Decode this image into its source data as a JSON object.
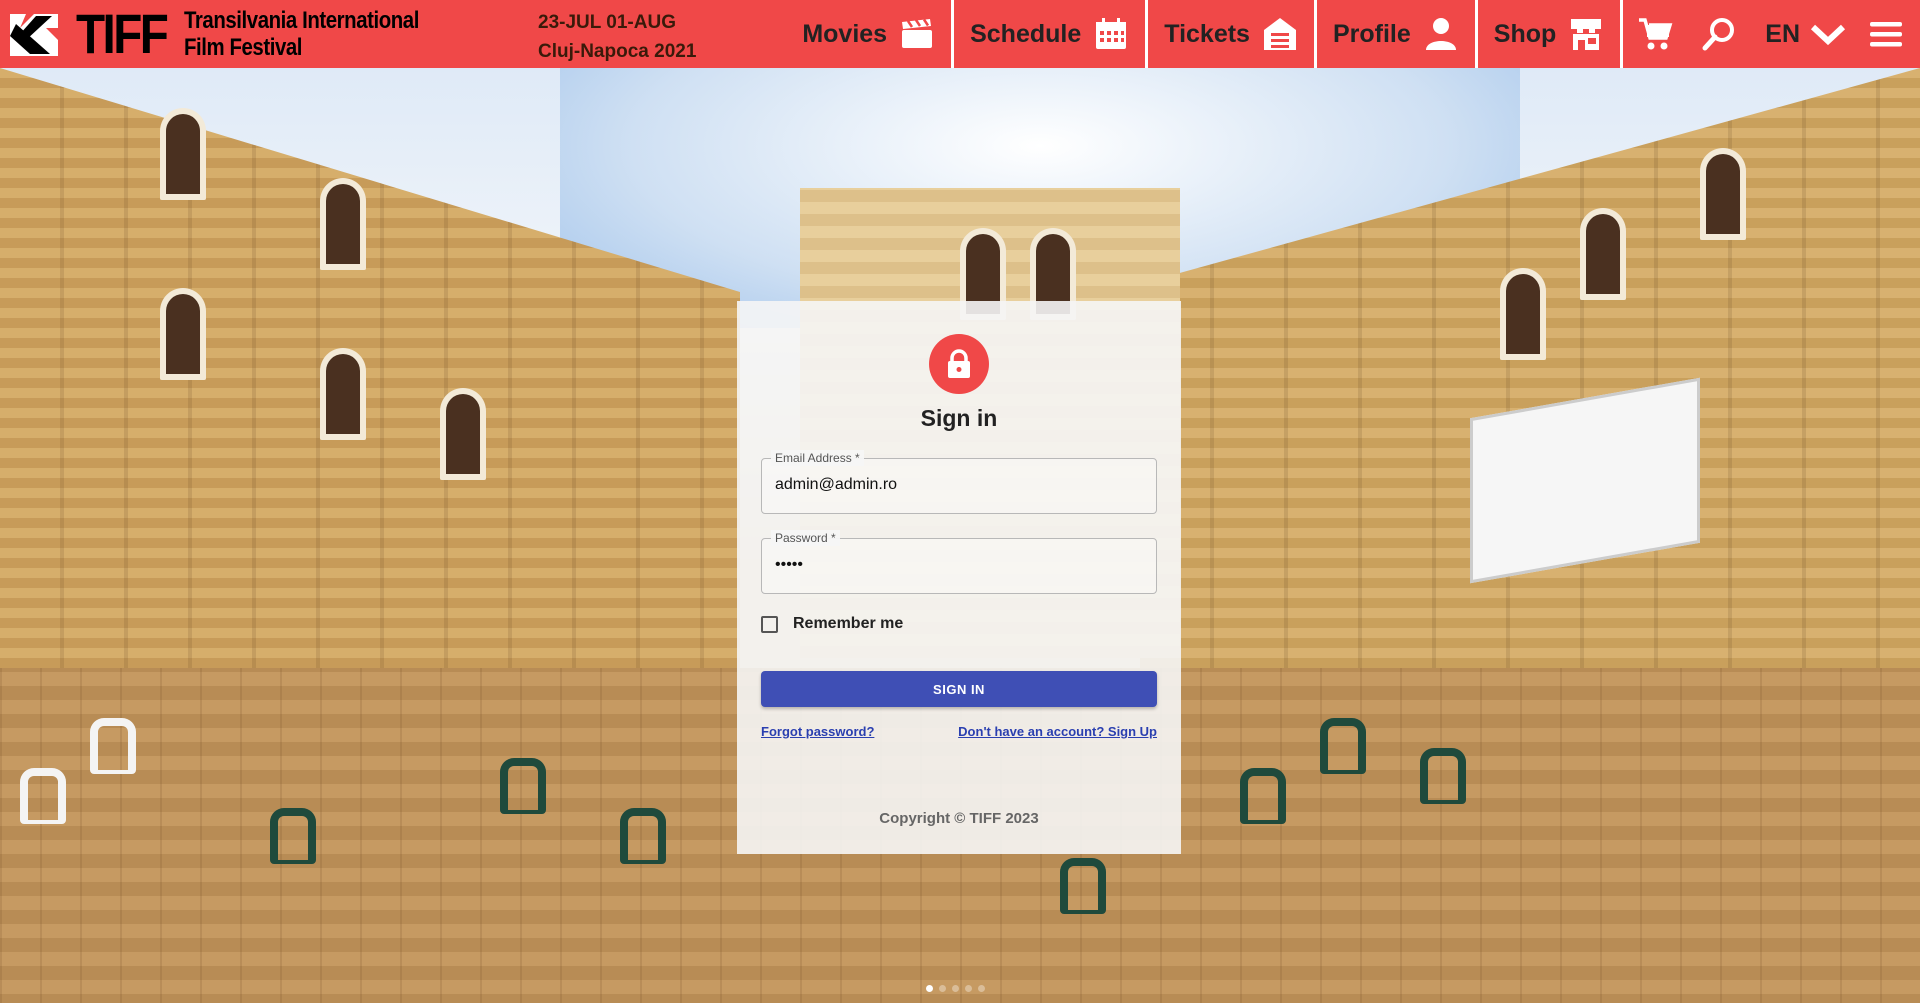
{
  "brand": {
    "logo_word": "TIFF",
    "name_line1": "Transilvania International",
    "name_line2": "Film Festival",
    "dates": "23-JUL 01-AUG",
    "location": "Cluj-Napoca 2021",
    "accent_color": "#f04848"
  },
  "nav": {
    "movies": "Movies",
    "schedule": "Schedule",
    "tickets": "Tickets",
    "profile": "Profile",
    "shop": "Shop",
    "language": "EN",
    "icons": [
      "clapperboard-icon",
      "calendar-icon",
      "ticket-icon",
      "user-icon",
      "shop-icon",
      "cart-icon",
      "search-icon",
      "chevron-down-icon",
      "menu-icon"
    ]
  },
  "signin": {
    "title": "Sign in",
    "email_label": "Email Address *",
    "email_value": "admin@admin.ro",
    "password_label": "Password *",
    "password_value": "•••••",
    "remember_label": "Remember me",
    "button_label": "SIGN IN",
    "forgot_link": "Forgot password?",
    "signup_link": "Don't have an account? Sign Up",
    "copyright": "Copyright © TIFF 2023",
    "button_color": "#3f4fb5"
  },
  "carousel": {
    "slides": 5,
    "active_index": 0
  }
}
